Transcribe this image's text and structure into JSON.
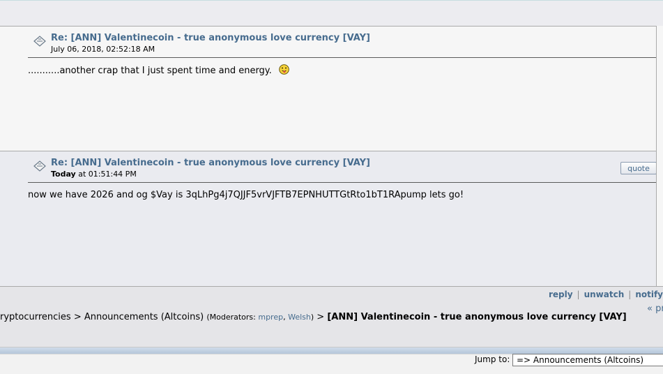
{
  "posts": [
    {
      "subject": "Re: [ANN] Valentinecoin - true anonymous love currency [VAY]",
      "date": "July 06, 2018, 02:52:18 AM",
      "body": "...........another crap that I just spent time and energy."
    },
    {
      "subject": "Re: [ANN] Valentinecoin - true anonymous love currency [VAY]",
      "date_bold": "Today",
      "date_rest": " at 01:51:44 PM",
      "body": "now we have 2026 and og $Vay is 3qLhPg4j7QJJF5vrVJFTB7EPNHUTTGtRto1bT1RApump  lets go!",
      "quote_label": "quote"
    }
  ],
  "actions": {
    "reply": "reply",
    "unwatch": "unwatch",
    "notify": "notify",
    "separator": "|"
  },
  "prev_label": "« pr",
  "linktree": {
    "parent": "ryptocurrencies",
    "sep": ">",
    "board": "Announcements (Altcoins)",
    "moderators_open": "(Moderators:",
    "mod1": "mprep",
    "mod_sep": ",",
    "mod2": "Welsh",
    "moderators_close": ")",
    "topic": "[ANN] Valentinecoin - true anonymous love currency [VAY]"
  },
  "jump": {
    "label": "Jump to:",
    "selected": "=> Announcements (Altcoins)"
  },
  "colors": {
    "link": "#476c8e",
    "post_bg_1": "#f6f6f6",
    "post_bg_2": "#eaebf0",
    "bar": "#b5c6da"
  }
}
